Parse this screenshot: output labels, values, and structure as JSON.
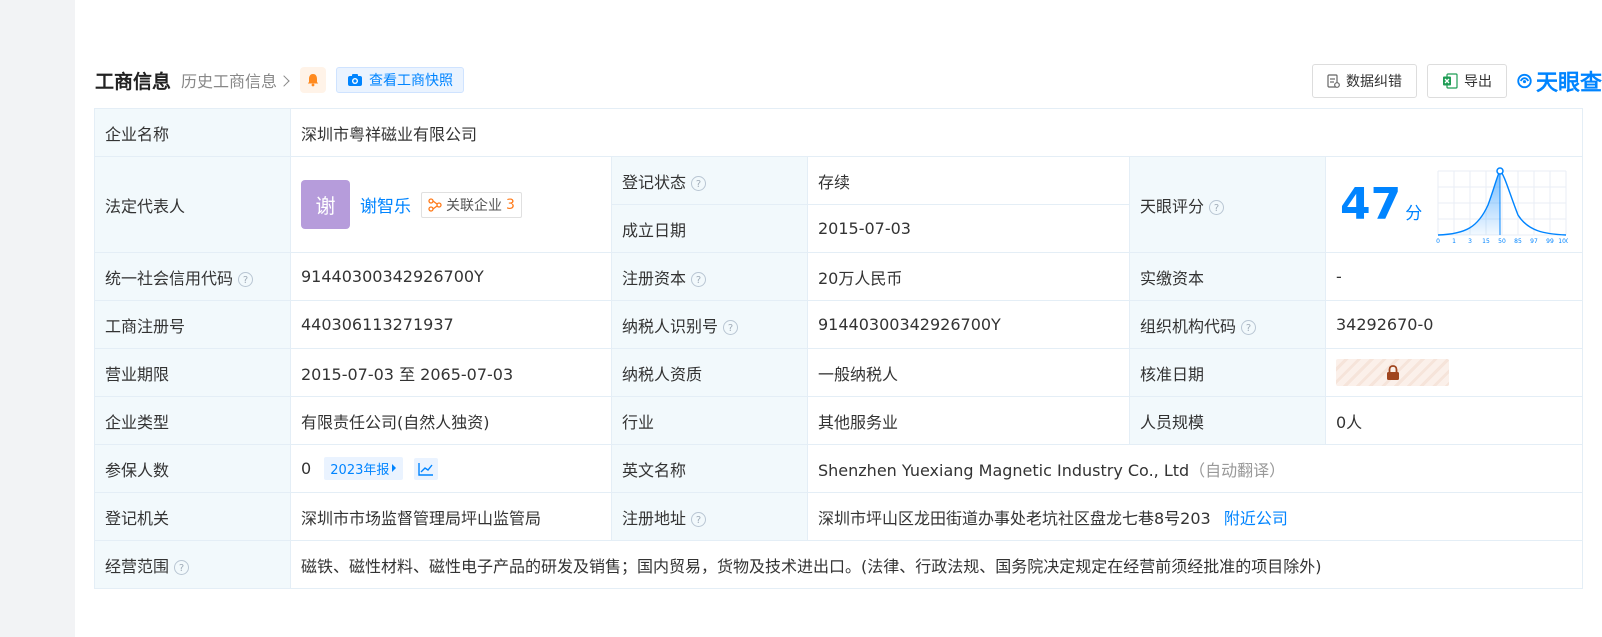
{
  "header": {
    "title": "工商信息",
    "history": "历史工商信息",
    "snapshot": "查看工商快照"
  },
  "tools": {
    "correct": "数据纠错",
    "export": "导出",
    "brand": "天眼查"
  },
  "company": {
    "name_label": "企业名称",
    "name": "深圳市粤祥磁业有限公司",
    "legal_label": "法定代表人",
    "legal_avatar": "谢",
    "legal_name": "谢智乐",
    "related_label": "关联企业",
    "related_count": "3",
    "status_label": "登记状态",
    "status": "存续",
    "founded_label": "成立日期",
    "founded": "2015-07-03",
    "score_label": "天眼评分",
    "score": "47",
    "score_unit": "分",
    "score_ticks": [
      "0",
      "1",
      "3",
      "15",
      "50",
      "85",
      "97",
      "99",
      "100"
    ],
    "credit_label": "统一社会信用代码",
    "credit_code": "91440300342926700Y",
    "capital_label": "注册资本",
    "capital": "20万人民币",
    "paid_label": "实缴资本",
    "paid": "-",
    "reg_label": "工商注册号",
    "reg_no": "440306113271937",
    "tax_label": "纳税人识别号",
    "tax_no": "91440300342926700Y",
    "org_label": "组织机构代码",
    "org_code": "34292670-0",
    "term_label": "营业期限",
    "term": "2015-07-03 至 2065-07-03",
    "taxq_label": "纳税人资质",
    "taxq": "一般纳税人",
    "approve_label": "核准日期",
    "type_label": "企业类型",
    "type": "有限责任公司(自然人独资)",
    "industry_label": "行业",
    "industry": "其他服务业",
    "staff_label": "人员规模",
    "staff": "0人",
    "insured_label": "参保人数",
    "insured": "0",
    "insured_report": "2023年报",
    "en_label": "英文名称",
    "en_name": "Shenzhen Yuexiang Magnetic Industry Co., Ltd",
    "en_auto": "（自动翻译）",
    "authority_label": "登记机关",
    "authority": "深圳市市场监督管理局坪山监管局",
    "address_label": "注册地址",
    "address": "深圳市坪山区龙田街道办事处老坑社区盘龙七巷8号203",
    "nearby": "附近公司",
    "scope_label": "经营范围",
    "scope": "磁铁、磁性材料、磁性电子产品的研发及销售；国内贸易，货物及技术进出口。(法律、行政法规、国务院决定规定在经营前须经批准的项目除外)"
  },
  "colors": {
    "accent": "#0084ff",
    "status_green": "#23a34a",
    "label_bg": "#f2f9fc",
    "avatar": "#b69cdb"
  }
}
